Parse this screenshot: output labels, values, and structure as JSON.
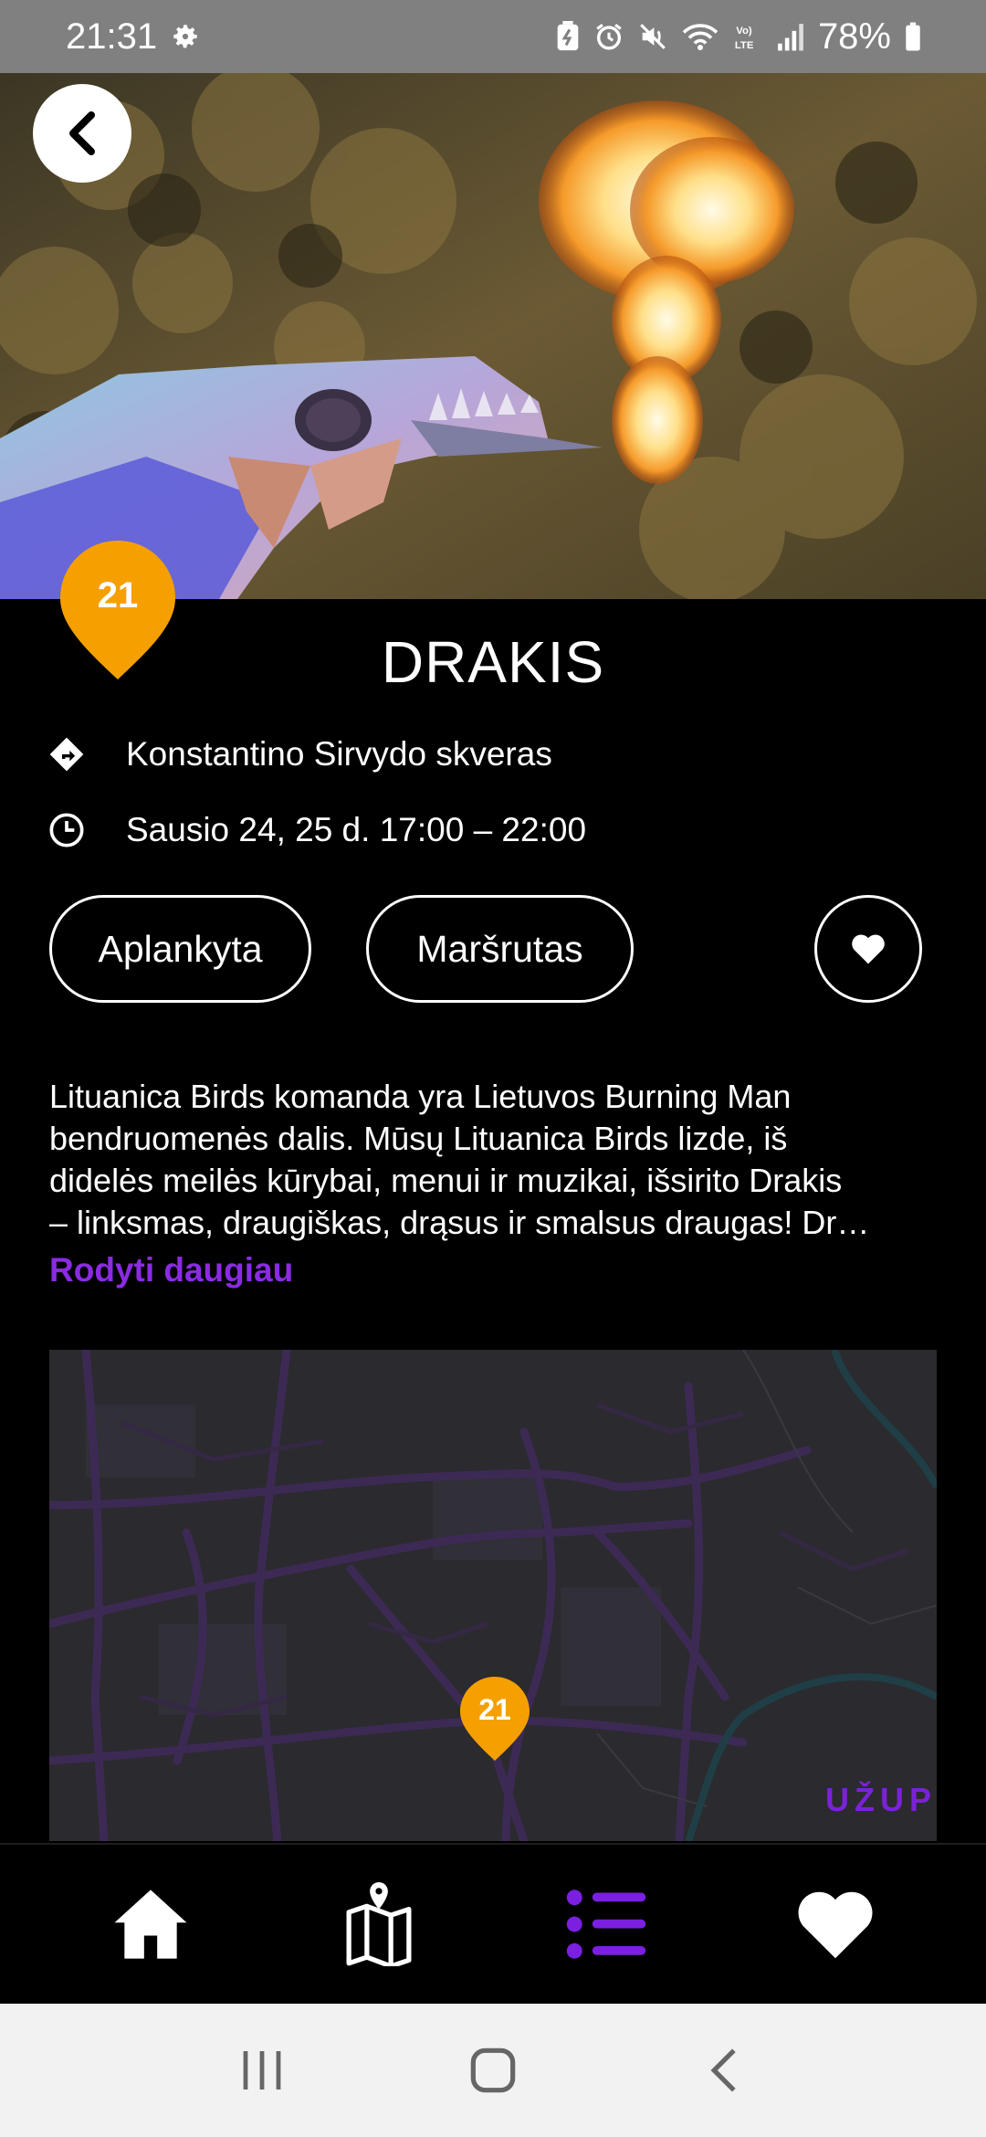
{
  "status_bar": {
    "time": "21:31",
    "battery": "78%",
    "icons": [
      "gear-icon",
      "battery-saver-icon",
      "alarm-icon",
      "mute-icon",
      "wifi-icon",
      "volte-icon",
      "signal-icon",
      "battery-icon"
    ]
  },
  "hero": {
    "image": "fire-breathing-dragon-sculpture"
  },
  "pin": {
    "number": "21",
    "color": "#F5A000"
  },
  "event": {
    "title": "DRAKIS",
    "location": "Konstantino Sirvydo skveras",
    "datetime": "Sausio 24, 25 d. 17:00 – 22:00"
  },
  "actions": {
    "visited_label": "Aplankyta",
    "route_label": "Maršrutas"
  },
  "description": {
    "lines": [
      "Lituanica Birds komanda yra Lietuvos Burning Man",
      "bendruomenės dalis. Mūsų Lituanica Birds lizde, iš",
      "didelės meilės kūrybai, menui ir muzikai, išsirito Drakis",
      "– linksmas, draugiškas, drąsus ir smalsus draugas! Dr…"
    ],
    "show_more": "Rodyti daugiau"
  },
  "map": {
    "pin_number": "21",
    "district_label": "UŽUPIS"
  },
  "bottom_nav": {
    "items": [
      "home-icon",
      "map-icon",
      "list-icon",
      "heart-icon"
    ],
    "active": "list-icon",
    "accent": "#7B1FE0"
  },
  "system_nav": [
    "recents-icon",
    "home-circle-icon",
    "back-icon"
  ]
}
